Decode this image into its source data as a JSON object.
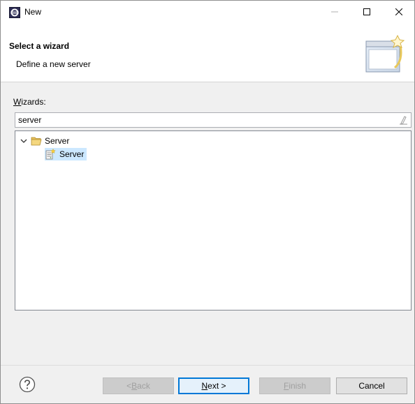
{
  "window": {
    "title": "New",
    "controls": {
      "minimize": "minimize-icon",
      "maximize": "maximize-icon",
      "close": "close-icon"
    }
  },
  "banner": {
    "title": "Select a wizard",
    "description": "Define a new server"
  },
  "wizards": {
    "label_mnemonic": "W",
    "label_rest": "izards:",
    "filter_value": "server",
    "tree": [
      {
        "label": "Server",
        "expanded": true,
        "icon": "folder-open-icon",
        "children": [
          {
            "label": "Server",
            "icon": "new-server-icon",
            "selected": true
          }
        ]
      }
    ]
  },
  "buttons": {
    "help_icon": "help-icon",
    "back": {
      "prefix": "< ",
      "mnemonic": "B",
      "rest": "ack",
      "enabled": false
    },
    "next": {
      "mnemonic": "N",
      "rest": "ext >",
      "enabled": true
    },
    "finish": {
      "mnemonic": "F",
      "rest": "inish",
      "enabled": false
    },
    "cancel": {
      "label": "Cancel",
      "enabled": true
    }
  },
  "colors": {
    "selection": "#cce8ff",
    "default_button_border": "#0078d7",
    "dialog_bg": "#f0f0f0"
  }
}
